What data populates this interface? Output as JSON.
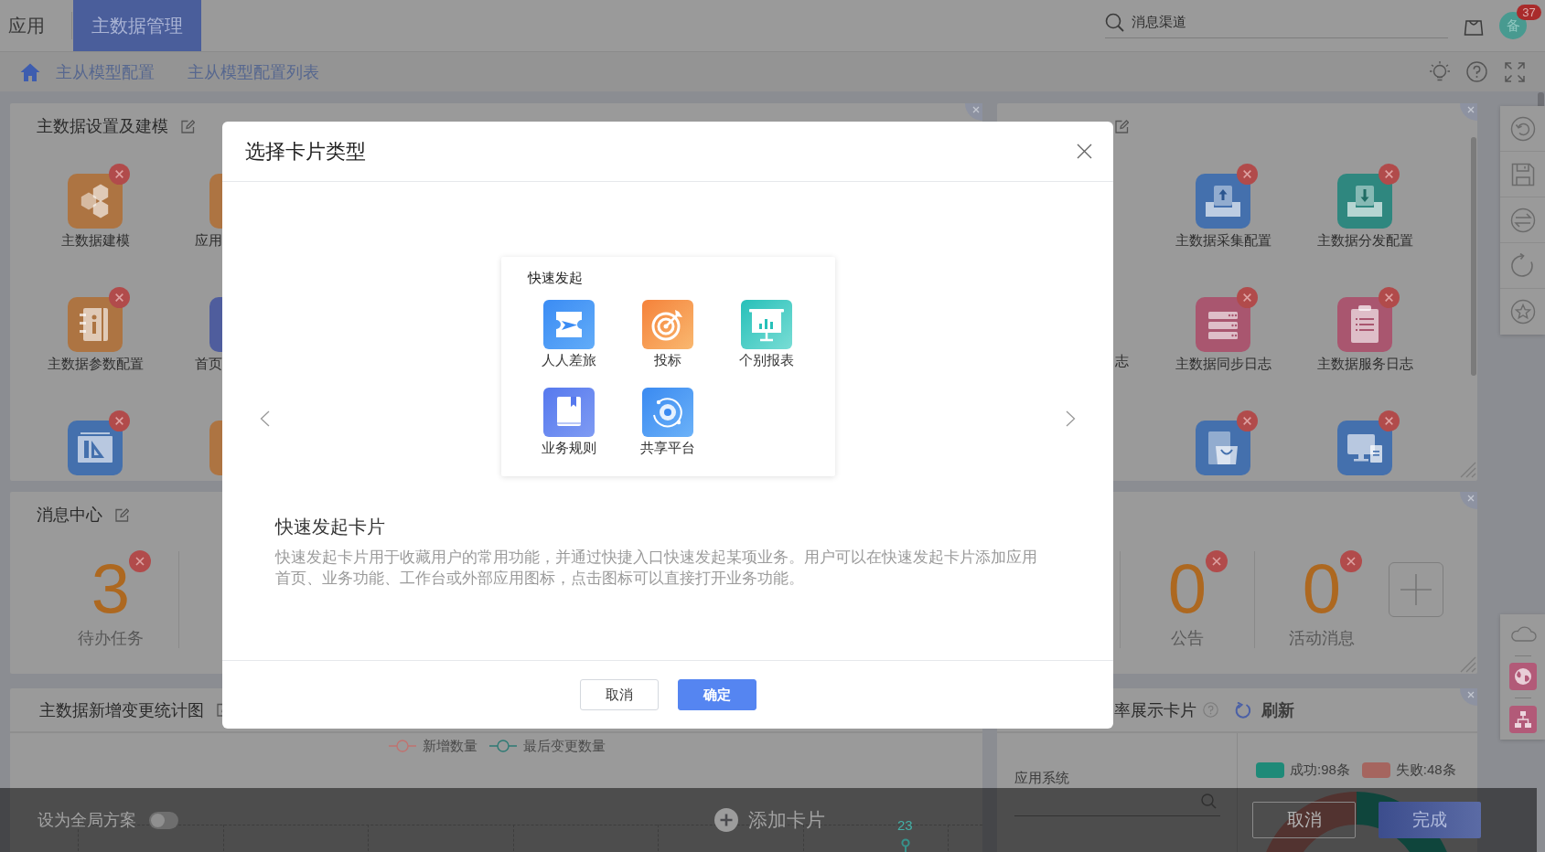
{
  "top_bar": {
    "tabs": [
      {
        "label": "应用",
        "selected": false
      },
      {
        "label": "主数据管理",
        "selected": true
      }
    ],
    "search": {
      "value": "消息渠道"
    },
    "avatar": {
      "initial": "备",
      "badge": "37"
    }
  },
  "breadcrumb": {
    "items": [
      "主从模型配置",
      "主从模型配置列表"
    ]
  },
  "setup_card": {
    "title": "主数据设置及建模",
    "rows": [
      [
        {
          "kind": "full",
          "label": "主数据建模",
          "removable": true
        },
        {
          "kind": "clipped",
          "label": "应用"
        }
      ],
      [
        {
          "kind": "full",
          "label": "主数据参数配置",
          "removable": true
        },
        {
          "kind": "clipped",
          "label": "首页"
        }
      ],
      [
        {
          "kind": "full",
          "removable": true
        },
        {
          "kind": "clipped"
        }
      ]
    ]
  },
  "integration_card": {
    "rows": [
      [
        "",
        {
          "kind": "full",
          "label": "主数据采集配置",
          "removable": true
        },
        {
          "kind": "full",
          "label": "主数据分发配置",
          "removable": true
        }
      ],
      [
        {
          "kind": "edge",
          "label": "志"
        },
        {
          "kind": "full",
          "label": "主数据同步日志",
          "removable": true
        },
        {
          "kind": "full",
          "label": "主数据服务日志",
          "removable": true
        }
      ],
      [
        "",
        {
          "kind": "full",
          "removable": true
        },
        {
          "kind": "full",
          "removable": true
        }
      ]
    ]
  },
  "message_card": {
    "title": "消息中心",
    "stats_left": [
      {
        "value": "3",
        "label": "待办任务",
        "removable": true
      }
    ],
    "stats_right": [
      {
        "value": "0",
        "label": "公告",
        "removable": true
      },
      {
        "value": "0",
        "label": "活动消息",
        "removable": true
      }
    ]
  },
  "trend_card": {
    "title": "主数据新增变更统计图",
    "legend": [
      {
        "name": "新增数量",
        "color": "#c07370"
      },
      {
        "name": "最后变更数量",
        "color": "#2e7a74",
        "point_label": "23"
      }
    ]
  },
  "rate_card": {
    "title": "率展示卡片",
    "refresh": "刷新",
    "filter": {
      "label": "应用系统"
    },
    "legend": [
      {
        "label": "成功:98条",
        "color": "#1e8a78"
      },
      {
        "label": "失败:48条",
        "color": "#a5655f"
      }
    ]
  },
  "bottom_bar": {
    "global_toggle": {
      "label": "设为全局方案",
      "on": false
    },
    "add_card": "添加卡片",
    "buttons": [
      {
        "label": "取消",
        "kind": "secondary"
      },
      {
        "label": "完成",
        "kind": "primary"
      }
    ]
  },
  "modal": {
    "title": "选择卡片类型",
    "preview": {
      "title": "快速发起",
      "apps": [
        {
          "label": "人人差旅"
        },
        {
          "label": "投标"
        },
        {
          "label": "个别报表"
        },
        {
          "label": "业务规则"
        },
        {
          "label": "共享平台"
        }
      ]
    },
    "card_name": "快速发起卡片",
    "description": "快速发起卡片用于收藏用户的常用功能，并通过快捷入口快速发起某项业务。用户可以在快速发起卡片添加应用首页、业务功能、工作台或外部应用图标，点击图标可以直接打开业务功能。",
    "buttons": [
      {
        "label": "取消",
        "kind": "secondary"
      },
      {
        "label": "确定",
        "kind": "primary"
      }
    ]
  }
}
